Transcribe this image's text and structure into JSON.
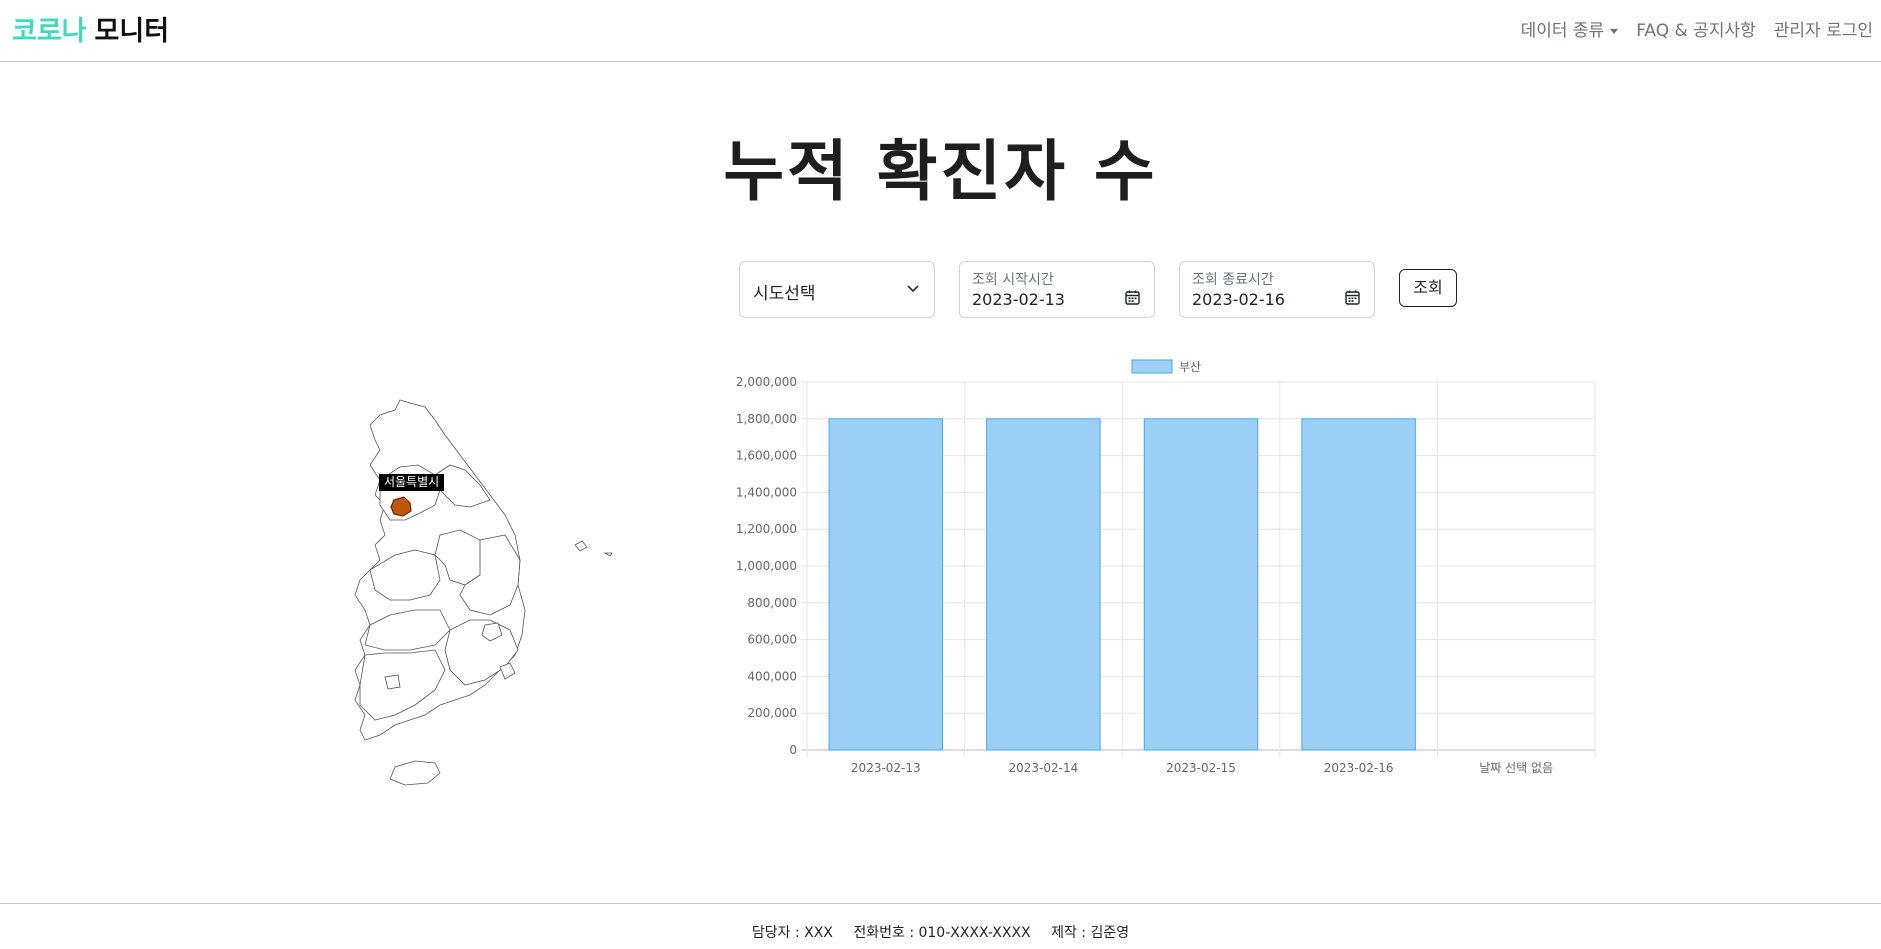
{
  "nav": {
    "brand_part1": "코로나",
    "brand_part2": "모니터",
    "links": [
      {
        "label": "데이터 종류"
      },
      {
        "label": "FAQ & 공지사항"
      },
      {
        "label": "관리자 로그인"
      }
    ]
  },
  "title": "누적 확진자 수",
  "controls": {
    "region_select": "시도선택",
    "start_label": "조회 시작시간",
    "start_value": "2023-02-13",
    "end_label": "조회 종료시간",
    "end_value": "2023-02-16",
    "search_button": "조회"
  },
  "map": {
    "tooltip": "서울특별시",
    "highlight_color": "#c0580a"
  },
  "chart_data": {
    "type": "bar",
    "categories": [
      "2023-02-13",
      "2023-02-14",
      "2023-02-15",
      "2023-02-16",
      "날짜 선택 없음"
    ],
    "series": [
      {
        "name": "부산",
        "values": [
          1800000,
          1800000,
          1800000,
          1800000,
          null
        ],
        "color": "#9ccff5",
        "border": "#4aa8e8"
      }
    ],
    "ylim": [
      0,
      2000000
    ],
    "yticks": [
      "0",
      "200,000",
      "400,000",
      "600,000",
      "800,000",
      "1,000,000",
      "1,200,000",
      "1,400,000",
      "1,600,000",
      "1,800,000",
      "2,000,000"
    ],
    "legend_position": "top",
    "grid": true
  },
  "footer": {
    "manager": "담당자 : XXX",
    "phone": "전화번호 : 010-XXXX-XXXX",
    "maker": "제작 : 김준영"
  }
}
